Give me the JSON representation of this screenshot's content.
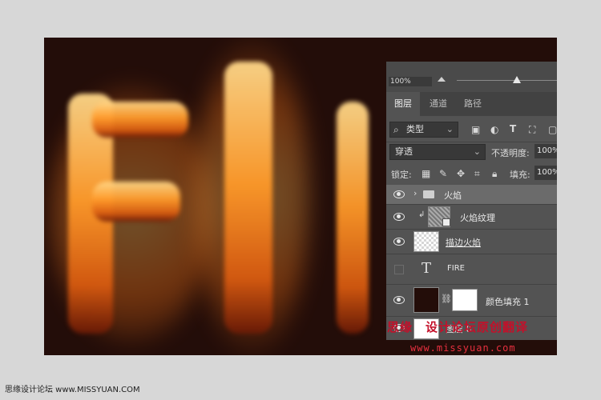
{
  "panel": {
    "opacity_top": "100%",
    "tabs": [
      "图层",
      "通道",
      "路径"
    ],
    "filter_kind": "类型",
    "blend_mode": "穿透",
    "opacity_label": "不透明度:",
    "opacity_value": "100%",
    "lock_label": "锁定:",
    "fill_label": "填充:",
    "fill_value": "100%",
    "layers": [
      {
        "name": "火焰",
        "type": "group",
        "visible": true,
        "selected": true
      },
      {
        "name": "火焰纹理",
        "type": "clipped-smart",
        "visible": true,
        "selected": false
      },
      {
        "name": "描边火焰",
        "type": "pixel",
        "visible": true,
        "selected": false
      },
      {
        "name": "FIRE",
        "type": "text",
        "visible": false,
        "selected": false,
        "icon_glyph": "T"
      },
      {
        "name": "颜色填充 1",
        "type": "fill",
        "visible": true,
        "selected": false
      },
      {
        "name": "图层 0",
        "type": "pixel",
        "visible": true,
        "selected": false
      }
    ]
  },
  "watermark": {
    "red_text": "思缘　设计论坛原创翻译",
    "url": "www.missyuan.com"
  },
  "footer": "思缘设计论坛 www.MISSYUAN.COM",
  "colors": {
    "canvas_bg": "#230d09",
    "panel_bg": "#535353",
    "selected_row": "#6b6b6b",
    "watermark_red": "#c4102a"
  }
}
